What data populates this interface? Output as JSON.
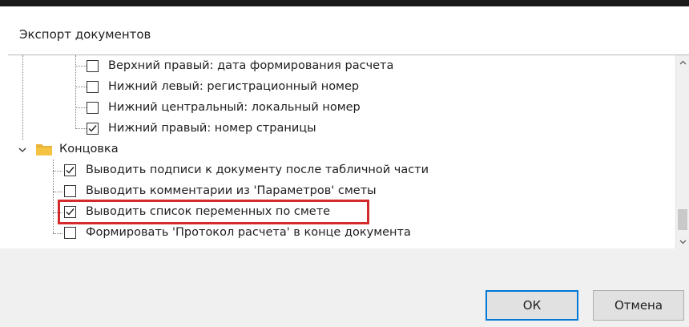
{
  "dialog": {
    "title": "Экспорт документов"
  },
  "tree": {
    "items": [
      {
        "label": "Верхний правый: дата формирования расчета",
        "checked": false
      },
      {
        "label": "Нижний левый: регистрационный номер",
        "checked": false
      },
      {
        "label": "Нижний центральный: локальный номер",
        "checked": false
      },
      {
        "label": "Нижний правый: номер страницы",
        "checked": true
      },
      {
        "label": "Концовка",
        "type": "folder",
        "expanded": true
      },
      {
        "label": "Выводить подписи к документу после табличной части",
        "checked": true
      },
      {
        "label": "Выводить комментарии из 'Параметров' сметы",
        "checked": false
      },
      {
        "label": "Выводить список переменных по смете",
        "checked": true,
        "highlighted": true
      },
      {
        "label": "Формировать 'Протокол расчета' в конце документа",
        "checked": false
      }
    ]
  },
  "buttons": {
    "ok_label": "ОК",
    "cancel_label": "Отмена"
  },
  "colors": {
    "highlight": "#d42a2a",
    "focus_border": "#0078d7",
    "folder": "#f5c342"
  }
}
